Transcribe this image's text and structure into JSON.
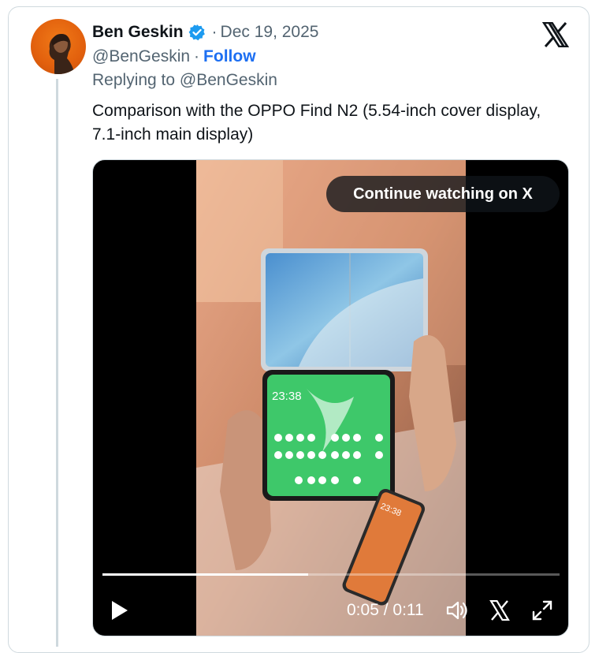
{
  "tweet": {
    "author_name": "Ben Geskin",
    "date_separator": "·",
    "date": "Dec 19, 2025",
    "handle": "@BenGeskin",
    "handle_separator": "·",
    "follow_label": "Follow",
    "replying_to": "Replying to @BenGeskin",
    "text": "Comparison with the OPPO Find N2 (5.54-inch cover display, 7.1-inch main display)"
  },
  "video": {
    "continue_label": "Continue watching on X",
    "progress": 0.45,
    "current_time": "0:05",
    "time_separator": " / ",
    "duration": "0:11",
    "phone_clock_1": "23:38",
    "phone_clock_2": "23:38"
  },
  "icons": {
    "verified": "verified-badge-icon",
    "x_logo": "x-logo-icon",
    "play": "play-icon",
    "volume": "volume-icon",
    "fullscreen": "fullscreen-icon"
  },
  "colors": {
    "verified_blue": "#1d9bf0",
    "follow_blue": "#1d6ff2",
    "avatar_orange": "#e2600d",
    "phone_screen_green": "#3ec86a"
  }
}
